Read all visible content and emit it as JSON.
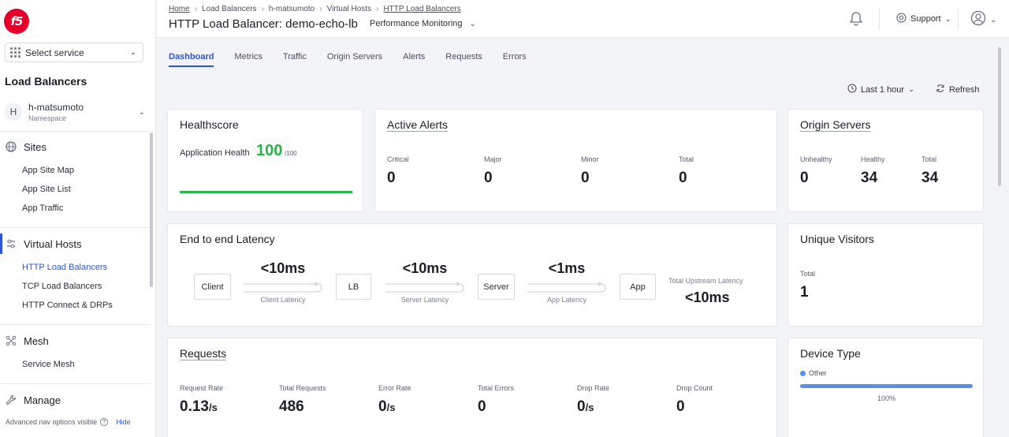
{
  "sidebar": {
    "logo_text": "f5",
    "service_select": "Select service",
    "section_title": "Load Balancers",
    "namespace": {
      "avatar": "H",
      "name": "h-matsumoto",
      "label": "Namespace"
    },
    "sites": {
      "label": "Sites",
      "items": [
        "App Site Map",
        "App Site List",
        "App Traffic"
      ]
    },
    "virtual_hosts": {
      "label": "Virtual Hosts",
      "items": [
        "HTTP Load Balancers",
        "TCP Load Balancers",
        "HTTP Connect & DRPs"
      ]
    },
    "mesh": {
      "label": "Mesh",
      "items": [
        "Service Mesh"
      ]
    },
    "manage": {
      "label": "Manage"
    },
    "footer": {
      "text": "Advanced nav options visible",
      "hide": "Hide"
    }
  },
  "header": {
    "breadcrumbs": [
      "Home",
      "Load Balancers",
      "h-matsumoto",
      "Virtual Hosts",
      "HTTP Load Balancers"
    ],
    "title": "HTTP Load Balancer: demo-echo-lb",
    "view_select": "Performance Monitoring",
    "support": "Support"
  },
  "tabs": [
    "Dashboard",
    "Metrics",
    "Traffic",
    "Origin Servers",
    "Alerts",
    "Requests",
    "Errors"
  ],
  "active_tab": "Dashboard",
  "toolbar": {
    "time_range": "Last 1 hour",
    "refresh": "Refresh"
  },
  "healthscore": {
    "title": "Healthscore",
    "label": "Application Health",
    "value": "100",
    "max": "/100",
    "fraction": 1.0
  },
  "active_alerts": {
    "title": "Active Alerts",
    "metrics": [
      {
        "label": "Critical",
        "value": "0"
      },
      {
        "label": "Major",
        "value": "0"
      },
      {
        "label": "Minor",
        "value": "0"
      },
      {
        "label": "Total",
        "value": "0"
      }
    ]
  },
  "origin_servers": {
    "title": "Origin Servers",
    "metrics": [
      {
        "label": "Unhealthy",
        "value": "0"
      },
      {
        "label": "Healthy",
        "value": "34"
      },
      {
        "label": "Total",
        "value": "34"
      }
    ]
  },
  "latency": {
    "title": "End to end Latency",
    "nodes": [
      "Client",
      "LB",
      "Server",
      "App"
    ],
    "segments": [
      {
        "value": "<10ms",
        "label": "Client Latency"
      },
      {
        "value": "<10ms",
        "label": "Server Latency"
      },
      {
        "value": "<1ms",
        "label": "App Latency"
      }
    ],
    "upstream_label": "Total Upstream Latency",
    "upstream_value": "<10ms"
  },
  "unique_visitors": {
    "title": "Unique Visitors",
    "label": "Total",
    "value": "1"
  },
  "requests": {
    "title": "Requests",
    "metrics": [
      {
        "label": "Request Rate",
        "value": "0.13",
        "unit": "/s"
      },
      {
        "label": "Total Requests",
        "value": "486",
        "unit": ""
      },
      {
        "label": "Error Rate",
        "value": "0",
        "unit": "/s"
      },
      {
        "label": "Total Errors",
        "value": "0",
        "unit": ""
      },
      {
        "label": "Drop Rate",
        "value": "0",
        "unit": "/s"
      },
      {
        "label": "Drop Count",
        "value": "0",
        "unit": ""
      }
    ]
  },
  "device_type": {
    "title": "Device Type",
    "legend": "Other",
    "percent_label": "100%",
    "fraction": 1.0
  },
  "colors": {
    "accent": "#2f55d4",
    "health": "#2ab34a",
    "device": "#5b8ee6",
    "logo": "#e4002b"
  }
}
